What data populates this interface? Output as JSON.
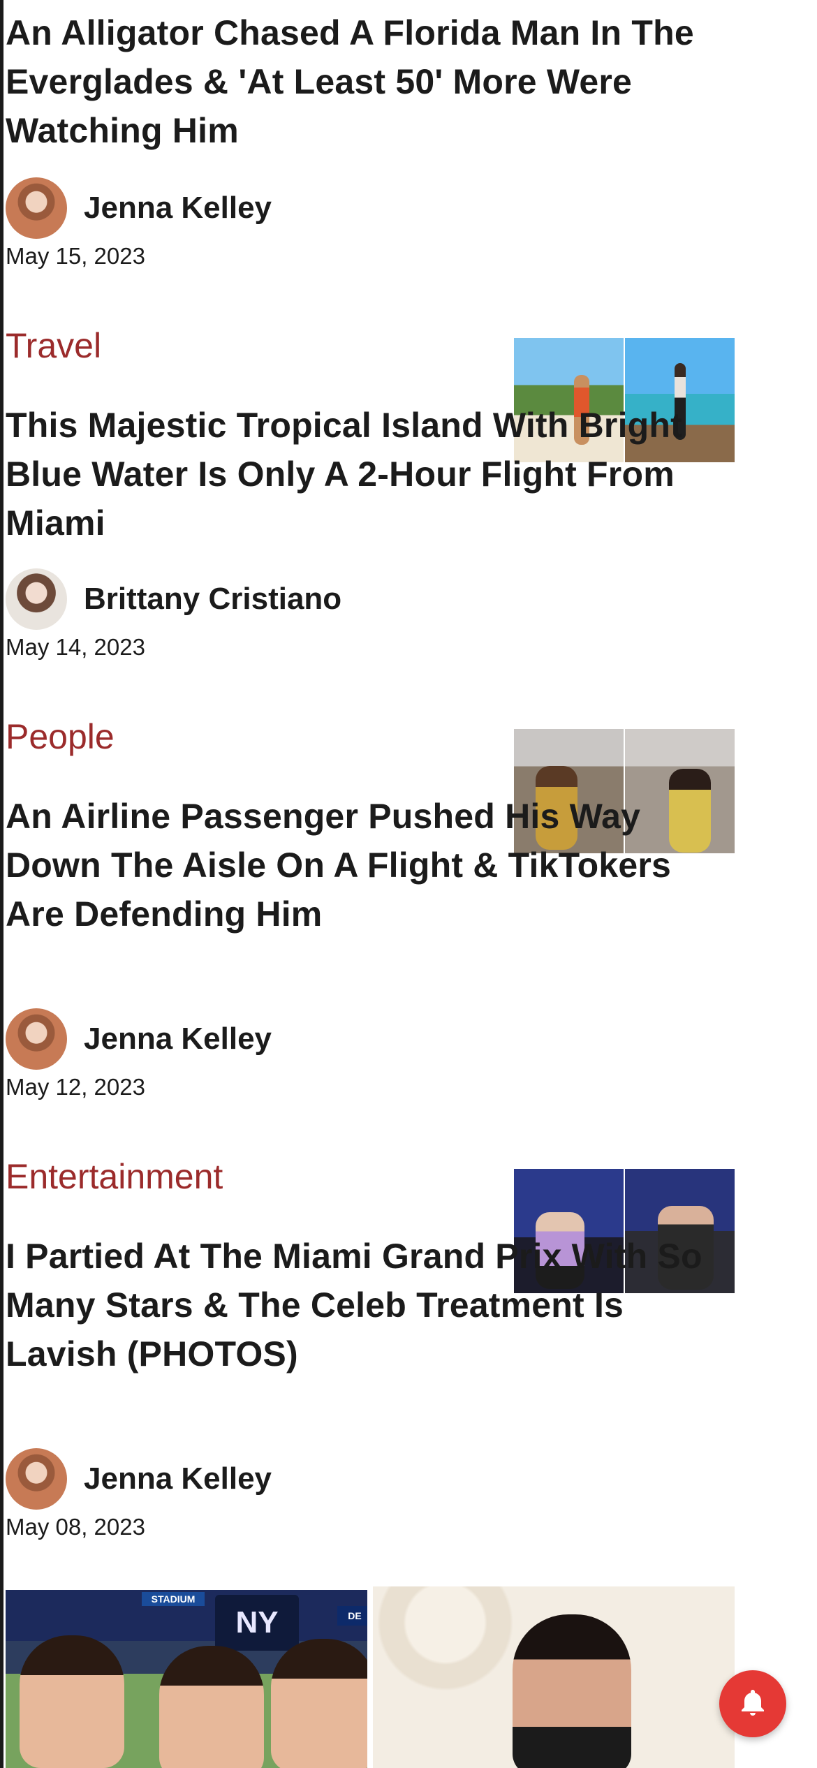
{
  "main_article": {
    "title": "An Alligator Chased A Florida Man In The Everglades & 'At Least 50' More Were Watching Him",
    "author": "Jenna Kelley",
    "date": "May 15, 2023"
  },
  "cards": [
    {
      "category": "Travel",
      "title": "This Majestic Tropical Island With Bright Blue Water Is Only A 2-Hour Flight From Miami",
      "author": "Brittany Cristiano",
      "date": "May 14, 2023"
    },
    {
      "category": "People",
      "title": "An Airline Passenger Pushed His Way Down The Aisle On A Flight & TikTokers Are Defending Him",
      "author": "Jenna Kelley",
      "date": "May 12, 2023"
    },
    {
      "category": "Entertainment",
      "title": "I Partied At The Miami Grand Prix With So Many Stars & The Celeb Treatment Is Lavish (PHOTOS)",
      "author": "Jenna Kelley",
      "date": "May 08, 2023"
    }
  ],
  "gallery": {
    "sign_left": "STADIUM",
    "sign_right": "DE",
    "logo": "NY"
  },
  "colors": {
    "category": "#9b2b2b",
    "bell": "#e53935"
  },
  "icons": {
    "notification": "bell-icon"
  }
}
